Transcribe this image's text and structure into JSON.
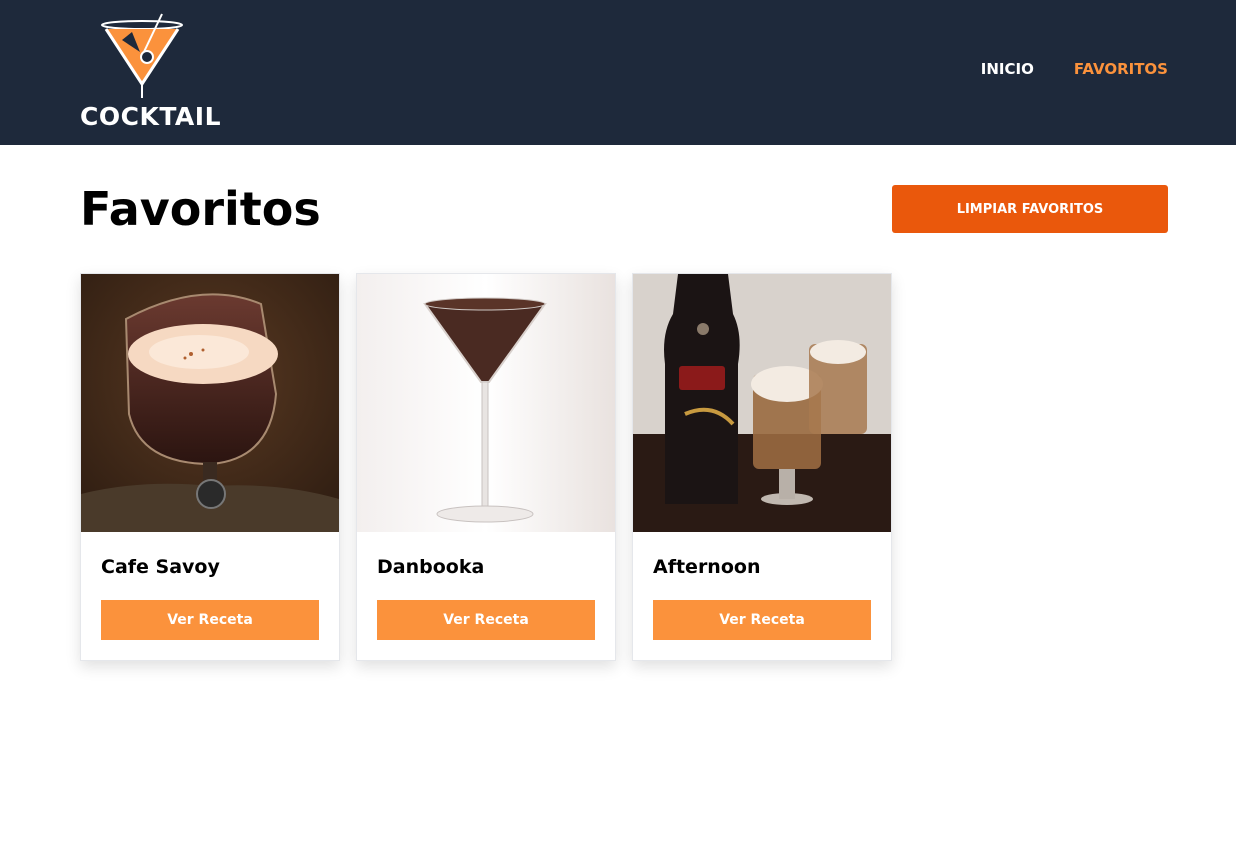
{
  "header": {
    "logo_text": "COCKTAIL",
    "nav": {
      "home_label": "INICIO",
      "favorites_label": "FAVORITOS"
    },
    "colors": {
      "background": "#1e293b",
      "active": "#fb923c"
    }
  },
  "main": {
    "title": "Favoritos",
    "clear_button_label": "LIMPIAR FAVORITOS"
  },
  "cards": [
    {
      "title": "Cafe Savoy",
      "button_label": "Ver Receta",
      "image": "cafe-savoy-drink-photo"
    },
    {
      "title": "Danbooka",
      "button_label": "Ver Receta",
      "image": "danbooka-martini-photo"
    },
    {
      "title": "Afternoon",
      "button_label": "Ver Receta",
      "image": "afternoon-baileys-photo"
    }
  ],
  "colors": {
    "accent": "#ea580c",
    "card_button": "#fb923c"
  }
}
